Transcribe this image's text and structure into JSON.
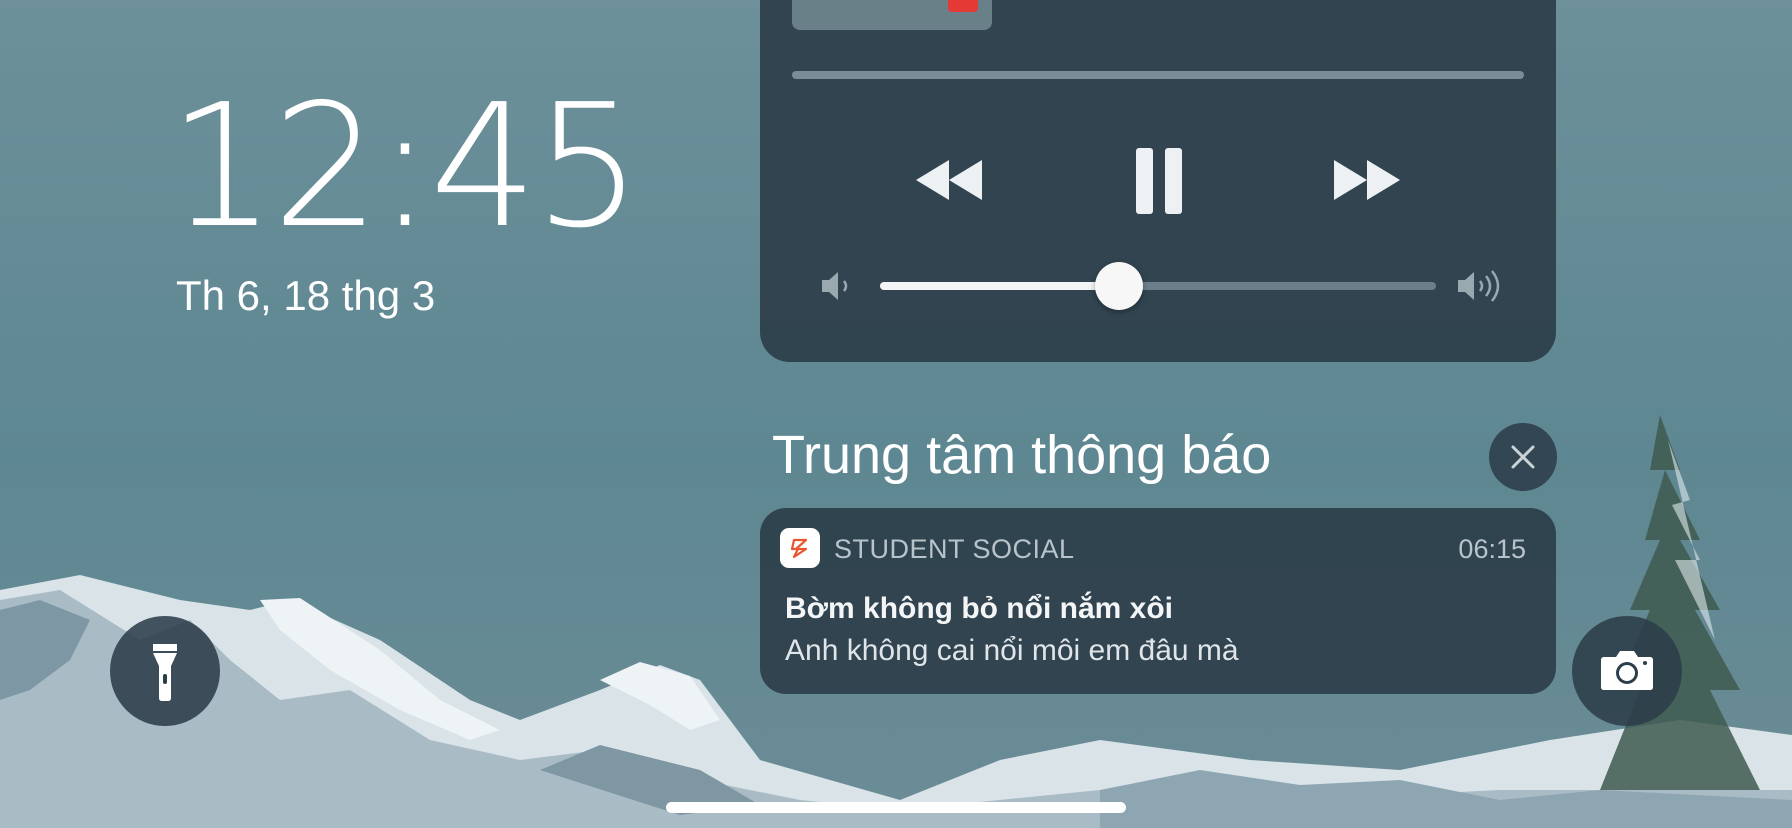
{
  "lock_screen": {
    "time": "12:45",
    "date": "Th 6, 18 thg 3"
  },
  "media_player": {
    "artwork_icon": "youtube-icon",
    "controls": [
      "rewind-icon",
      "pause-icon",
      "fast-forward-icon"
    ],
    "volume_level": 0.43,
    "volume_icons": [
      "volume-low-icon",
      "volume-high-icon"
    ]
  },
  "notification_center": {
    "title": "Trung tâm thông báo",
    "close_icon": "close-icon",
    "notifications": [
      {
        "app_name": "STUDENT SOCIAL",
        "time": "06:15",
        "title": "Bờm không bỏ nổi nắm xôi",
        "body": "Anh không cai nổi môi em đâu mà"
      }
    ]
  },
  "quick_actions": {
    "left_icon": "flashlight-icon",
    "right_icon": "camera-icon"
  },
  "colors": {
    "panel": "#2c3e4a",
    "badge_red": "#e53935",
    "app_accent": "#e8552f"
  }
}
